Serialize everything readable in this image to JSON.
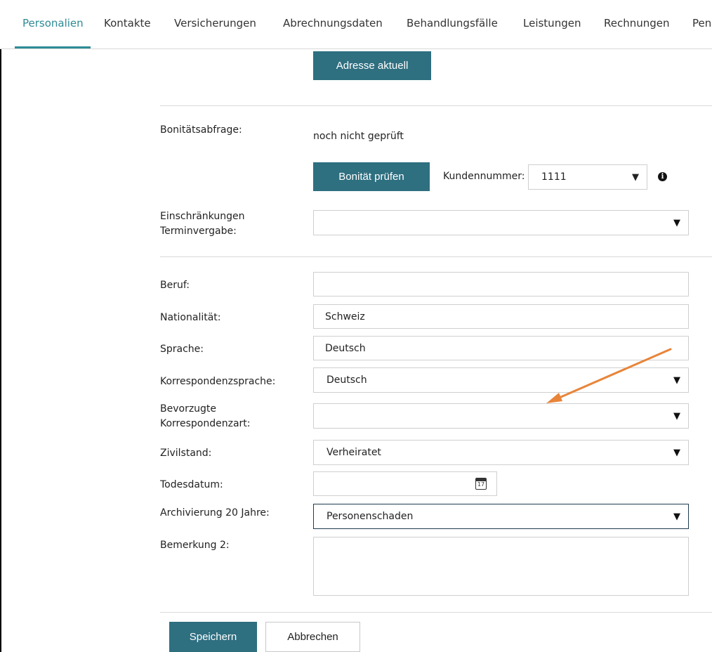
{
  "tabs": [
    {
      "label": "Personalien",
      "active": true
    },
    {
      "label": "Kontakte",
      "active": false
    },
    {
      "label": "Versicherungen",
      "active": false
    },
    {
      "label": "Abrechnungsdaten",
      "active": false
    },
    {
      "label": "Behandlungsfälle",
      "active": false
    },
    {
      "label": "Leistungen",
      "active": false
    },
    {
      "label": "Rechnungen",
      "active": false
    },
    {
      "label": "Pen",
      "active": false
    }
  ],
  "address_button": "Adresse aktuell",
  "credit": {
    "label": "Bonitätsabfrage:",
    "status": "noch nicht geprüft",
    "check_button": "Bonität prüfen",
    "customer_number_label": "Kundennummer:",
    "customer_number_value": "1111",
    "info_icon": "info-icon"
  },
  "scheduling": {
    "label_line1": "Einschränkungen",
    "label_line2": "Terminvergabe:",
    "value": ""
  },
  "form": {
    "profession": {
      "label": "Beruf:",
      "value": ""
    },
    "nationality": {
      "label": "Nationalität:",
      "value": "Schweiz"
    },
    "language": {
      "label": "Sprache:",
      "value": "Deutsch"
    },
    "correspondence_language": {
      "label": "Korrespondenzsprache:",
      "value": "Deutsch"
    },
    "preferred_correspondence": {
      "label_line1": "Bevorzugte",
      "label_line2": "Korrespondenzart:",
      "value": ""
    },
    "marital_status": {
      "label": "Zivilstand:",
      "value": "Verheiratet"
    },
    "date_of_death": {
      "label": "Todesdatum:",
      "value": "",
      "calendar_day": "17"
    },
    "archiving": {
      "label": "Archivierung 20 Jahre:",
      "value": "Personenschaden"
    },
    "remark": {
      "label": "Bemerkung 2:",
      "value": ""
    }
  },
  "actions": {
    "save": "Speichern",
    "cancel": "Abbrechen"
  },
  "colors": {
    "accent": "#2e8b96",
    "button": "#2e6f80",
    "annotation_arrow": "#e8853a"
  }
}
